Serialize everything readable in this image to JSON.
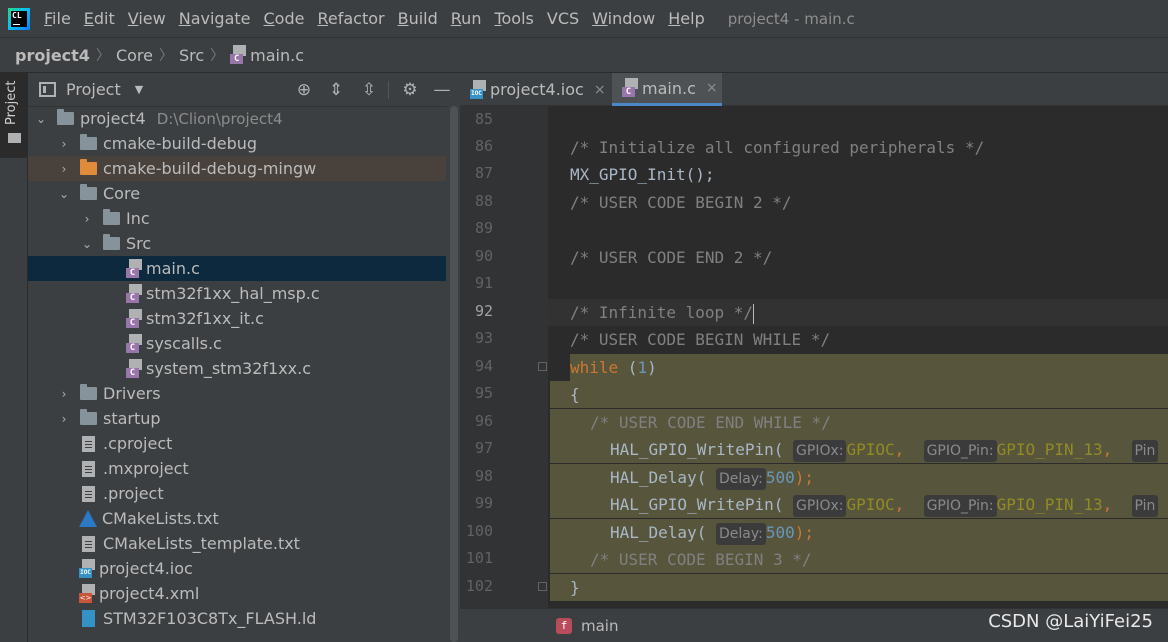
{
  "menubar": {
    "logo_text": "CL",
    "items": [
      {
        "mn": "F",
        "rest": "ile"
      },
      {
        "mn": "E",
        "rest": "dit"
      },
      {
        "mn": "V",
        "rest": "iew"
      },
      {
        "mn": "N",
        "rest": "avigate"
      },
      {
        "mn": "C",
        "rest": "ode"
      },
      {
        "mn": "R",
        "rest": "efactor"
      },
      {
        "mn": "B",
        "rest": "uild"
      },
      {
        "mn": "R",
        "rest": "un"
      },
      {
        "mn": "T",
        "rest": "ools"
      },
      {
        "mn": "",
        "rest": "VCS"
      },
      {
        "mn": "W",
        "rest": "indow"
      },
      {
        "mn": "H",
        "rest": "elp"
      }
    ],
    "window_title": "project4 - main.c"
  },
  "breadcrumb": {
    "project": "project4",
    "core": "Core",
    "src": "Src",
    "file": "main.c",
    "file_icon_letter": "C"
  },
  "left_stripe": {
    "label": "Project"
  },
  "project_panel": {
    "title": "Project",
    "dropdown_glyph": "▼",
    "buttons": {
      "locate": "⊕",
      "expand": "⇕",
      "collapse": "⇳",
      "settings": "⚙",
      "hide": "—"
    },
    "tree": [
      {
        "label": "project4",
        "path": "D:\\Clion\\project4",
        "twisty": "⌄",
        "icon": "folder"
      },
      {
        "label": "cmake-build-debug",
        "twisty": "›",
        "icon": "folder"
      },
      {
        "label": "cmake-build-debug-mingw",
        "twisty": "›",
        "icon": "folder-orange"
      },
      {
        "label": "Core",
        "twisty": "⌄",
        "icon": "folder"
      },
      {
        "label": "Inc",
        "twisty": "›",
        "icon": "folder"
      },
      {
        "label": "Src",
        "twisty": "⌄",
        "icon": "folder"
      },
      {
        "label": "main.c",
        "icon": "c-file"
      },
      {
        "label": "stm32f1xx_hal_msp.c",
        "icon": "c-file"
      },
      {
        "label": "stm32f1xx_it.c",
        "icon": "c-file"
      },
      {
        "label": "syscalls.c",
        "icon": "c-file"
      },
      {
        "label": "system_stm32f1xx.c",
        "icon": "c-file"
      },
      {
        "label": "Drivers",
        "twisty": "›",
        "icon": "folder"
      },
      {
        "label": "startup",
        "twisty": "›",
        "icon": "folder"
      },
      {
        "label": ".cproject",
        "icon": "text-file"
      },
      {
        "label": ".mxproject",
        "icon": "text-file"
      },
      {
        "label": ".project",
        "icon": "text-file"
      },
      {
        "label": "CMakeLists.txt",
        "icon": "cmake-icon"
      },
      {
        "label": "CMakeLists_template.txt",
        "icon": "text-file"
      },
      {
        "label": "project4.ioc",
        "icon": "ioc-file"
      },
      {
        "label": "project4.xml",
        "icon": "xml-file"
      },
      {
        "label": "STM32F103C8Tx_FLASH.ld",
        "icon": "ld-file"
      }
    ]
  },
  "editor": {
    "tabs": [
      {
        "label": "project4.ioc",
        "close": "×",
        "icon_letter": "IOC"
      },
      {
        "label": "main.c",
        "close": "×",
        "icon_letter": "C"
      }
    ],
    "line_numbers": [
      "85",
      "86",
      "87",
      "88",
      "89",
      "90",
      "91",
      "92",
      "93",
      "94",
      "95",
      "96",
      "97",
      "98",
      "99",
      "100",
      "101",
      "102"
    ],
    "code": {
      "l86": "/* Initialize all configured peripherals */",
      "l87": "MX_GPIO_Init();",
      "l88": "/* USER CODE BEGIN 2 */",
      "l90": "/* USER CODE END 2 */",
      "l92": "/* Infinite loop */",
      "l93": "/* USER CODE BEGIN WHILE */",
      "l94_kw": "while",
      "l94_open": " (",
      "l94_num": "1",
      "l94_close": ")",
      "l95": "{",
      "l96": "/* USER CODE END WHILE */",
      "l97_fn": "HAL_GPIO_WritePin(",
      "l97_hint1": "GPIOx:",
      "l97_arg1": "GPIOC",
      "l97_sep1": ",",
      "l97_hint2": "GPIO_Pin:",
      "l97_arg2": "GPIO_PIN_13",
      "l97_sep2": ",",
      "l97_hint3": "Pin",
      "l98_fn": "HAL_Delay(",
      "l98_hint": "Delay:",
      "l98_num": "500",
      "l98_end": ");",
      "l99_fn": "HAL_GPIO_WritePin(",
      "l99_hint1": "GPIOx:",
      "l99_arg1": "GPIOC",
      "l99_sep1": ",",
      "l99_hint2": "GPIO_Pin:",
      "l99_arg2": "GPIO_PIN_13",
      "l99_sep2": ",",
      "l99_hint3": "Pin",
      "l100_fn": "HAL_Delay(",
      "l100_hint": "Delay:",
      "l100_num": "500",
      "l100_end": ");",
      "l101": "/* USER CODE BEGIN 3 */",
      "l102": "}"
    },
    "status_badge": "f",
    "status_scope": "main"
  },
  "watermark": "CSDN @LaiYiFei25",
  "colors": {
    "background": "#2b2b2b",
    "panel": "#3c3f41",
    "selection": "#0d293e",
    "block_highlight": "#57553c",
    "keyword": "#cc7832",
    "comment": "#808080",
    "number": "#6897bb",
    "macro": "#908b25",
    "accent_tab": "#4a88c7"
  }
}
